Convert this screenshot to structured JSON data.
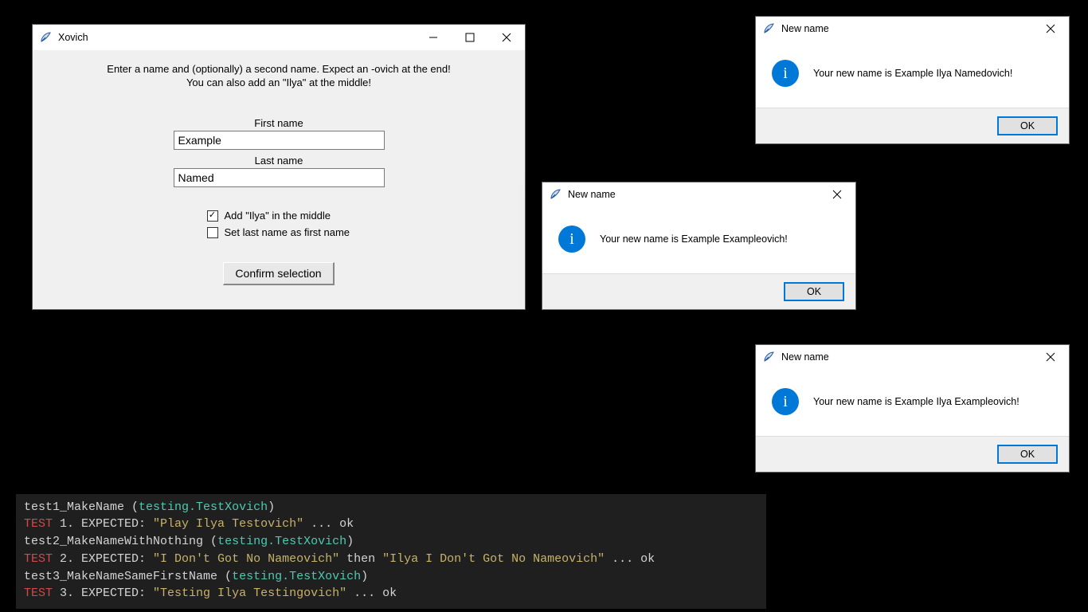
{
  "main_window": {
    "title": "Xovich",
    "instruction_line1": "Enter a name and (optionally) a second name. Expect an -ovich at the end!",
    "instruction_line2": "You can also add an \"Ilya\" at the middle!",
    "first_name_label": "First name",
    "first_name_value": "Example",
    "last_name_label": "Last name",
    "last_name_value": "Named",
    "checkbox_ilya_label": "Add \"Ilya\" in the middle",
    "checkbox_ilya_checked": "✓",
    "checkbox_lastfirst_label": "Set last name as first name",
    "confirm_label": "Confirm selection"
  },
  "msgboxes": [
    {
      "title": "New name",
      "text": "Your new name is Example Ilya Namedovich!",
      "ok": "OK"
    },
    {
      "title": "New name",
      "text": "Your new name is Example Exampleovich!",
      "ok": "OK"
    },
    {
      "title": "New name",
      "text": "Your new name is Example Ilya Exampleovich!",
      "ok": "OK"
    }
  ],
  "console": {
    "lines": [
      {
        "name": "test1_MakeName",
        "suite": "testing.TestXovich"
      },
      {
        "prefix": "TEST",
        "num": " 1. EXPECTED: ",
        "expected": "\"Play Ilya Testovich\"",
        "tail": " ... ok"
      },
      {
        "name": "test2_MakeNameWithNothing",
        "suite": "testing.TestXovich"
      },
      {
        "prefix": "TEST",
        "num": " 2. EXPECTED: ",
        "expected": "\"I Don't Got No Nameovich\"",
        "mid": " then ",
        "expected2": "\"Ilya I Don't Got No Nameovich\"",
        "tail": " ... ok"
      },
      {
        "name": "test3_MakeNameSameFirstName",
        "suite": "testing.TestXovich"
      },
      {
        "prefix": "TEST",
        "num": " 3. EXPECTED: ",
        "expected": "\"Testing Ilya Testingovich\"",
        "tail": " ... ok"
      }
    ]
  }
}
